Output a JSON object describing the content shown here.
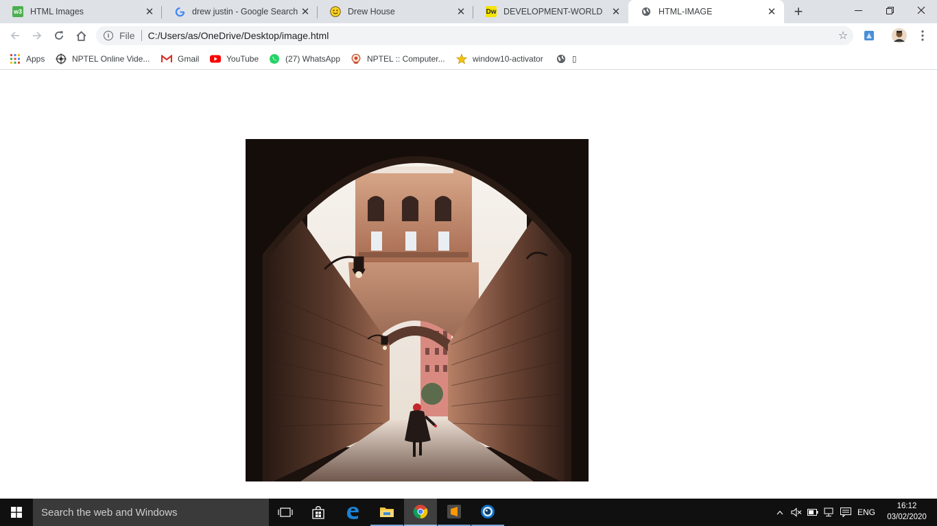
{
  "tabs": [
    {
      "title": "HTML Images",
      "favicon": "w3schools-icon",
      "active": false
    },
    {
      "title": "drew justin - Google Search",
      "favicon": "google-icon",
      "active": false
    },
    {
      "title": "Drew House",
      "favicon": "smiley-icon",
      "active": false
    },
    {
      "title": "DEVELOPMENT-WORLD",
      "favicon": "dreamweaver-icon",
      "favicon_text": "Dw",
      "active": false
    },
    {
      "title": "HTML-IMAGE",
      "favicon": "globe-icon",
      "active": true
    }
  ],
  "toolbar": {
    "scheme_label": "File",
    "url": "C:/Users/as/OneDrive/Desktop/image.html"
  },
  "bookmarks": [
    {
      "label": "Apps",
      "icon": "apps-grid-icon"
    },
    {
      "label": "NPTEL Online Vide...",
      "icon": "nptel-icon"
    },
    {
      "label": "Gmail",
      "icon": "gmail-icon"
    },
    {
      "label": "YouTube",
      "icon": "youtube-icon"
    },
    {
      "label": "(27) WhatsApp",
      "icon": "whatsapp-icon"
    },
    {
      "label": "NPTEL :: Computer...",
      "icon": "nptel-computer-icon"
    },
    {
      "label": "window10-activator",
      "icon": "star-bookmark-icon"
    },
    {
      "label": "▯",
      "icon": "globe-icon"
    }
  ],
  "content": {
    "image_subject": "archway-alley-photo"
  },
  "taskbar": {
    "search_placeholder": "Search the web and Windows",
    "language": "ENG",
    "time": "16:12",
    "date": "03/02/2020"
  },
  "colors": {
    "tabstrip": "#dee1e6",
    "taskbar": "#101010",
    "search_box": "#3a3a3a"
  }
}
